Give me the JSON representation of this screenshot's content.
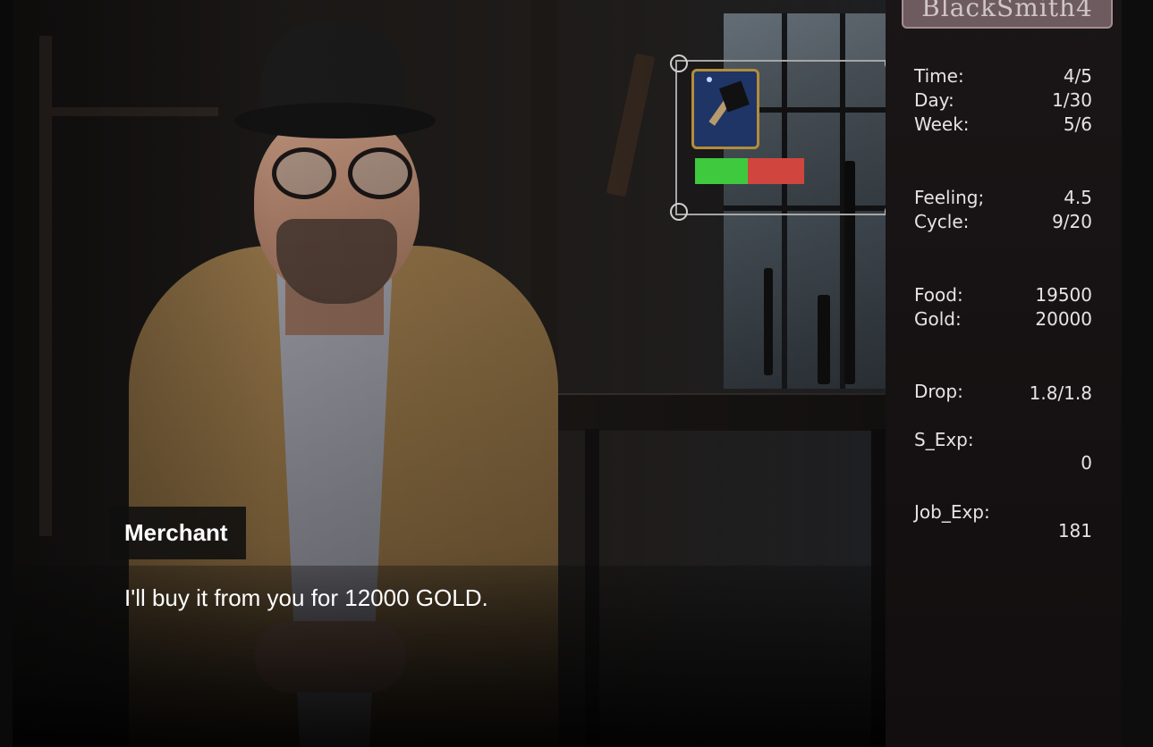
{
  "game": {
    "logo_text": "BlackSmith4"
  },
  "dialogue": {
    "speaker": "Merchant",
    "text": "I'll buy it from you for 12000 GOLD."
  },
  "item_slot": {
    "icon": "hammer-icon",
    "progress_fraction": 0.48,
    "progress_color": "#3ec93e",
    "remaining_color": "#d0463e"
  },
  "stats": {
    "time": {
      "label": "Time:",
      "value": "4/5"
    },
    "day": {
      "label": "Day:",
      "value": "1/30"
    },
    "week": {
      "label": "Week:",
      "value": "5/6"
    },
    "feeling": {
      "label": "Feeling;",
      "value": "4.5"
    },
    "cycle": {
      "label": "Cycle:",
      "value": "9/20"
    },
    "food": {
      "label": "Food:",
      "value": "19500"
    },
    "gold": {
      "label": "Gold:",
      "value": "20000"
    },
    "drop": {
      "label": "Drop:",
      "value": "1.8/1.8"
    },
    "s_exp": {
      "label": "S_Exp:",
      "value": "0"
    },
    "job_exp": {
      "label": "Job_Exp:",
      "value": "181"
    }
  }
}
